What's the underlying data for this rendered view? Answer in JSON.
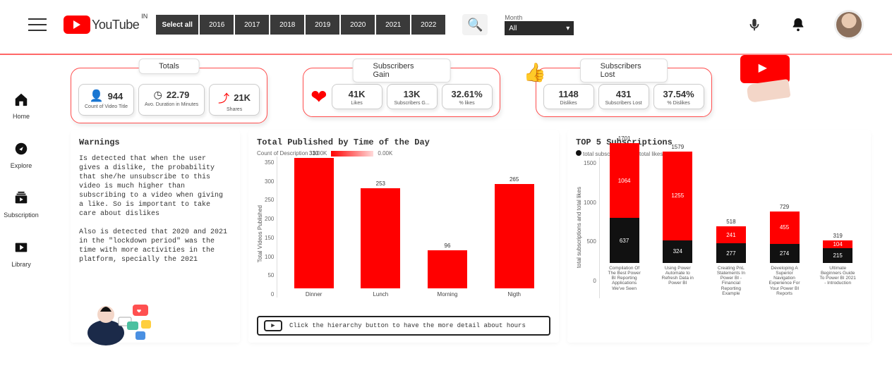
{
  "header": {
    "logo_text": "YouTube",
    "logo_sup": "IN",
    "select_all": "Select all",
    "years": [
      "2016",
      "2017",
      "2018",
      "2019",
      "2020",
      "2021",
      "2022"
    ],
    "month_label": "Month",
    "month_value": "All"
  },
  "nav": {
    "home": "Home",
    "explore": "Explore",
    "subscription": "Subscription",
    "library": "Library"
  },
  "kpi": {
    "totals": {
      "title": "Totals",
      "count_val": "944",
      "count_sub": "Count of Video Title",
      "dur_val": "22.79",
      "dur_sub": "Avo. Duration in Minutes",
      "shares_val": "21K",
      "shares_sub": "Shares"
    },
    "gain": {
      "title": "Subscribers Gain",
      "likes_val": "41K",
      "likes_sub": "Likes",
      "subg_val": "13K",
      "subg_sub": "Subscribers G...",
      "pct_val": "32.61%",
      "pct_sub": "% likes"
    },
    "lost": {
      "title": "Subscribers Lost",
      "dis_val": "1148",
      "dis_sub": "Dislikes",
      "subl_val": "431",
      "subl_sub": "Subscribers Lost",
      "pct_val": "37.54%",
      "pct_sub": "% Dislikes"
    }
  },
  "warnings": {
    "title": "Warnings",
    "p1": "Is detected that when the user gives a dislike, the probability that she/he unsubscribe to this video is much higher than subscribing to a video when giving a like. So is important to take care about dislikes",
    "p2": "Also is detected that 2020 and 2021 in the \"lockdown period\" was the time with more activities in the platform, specially the 2021"
  },
  "barchart": {
    "title": "Total Published by Time of the Day",
    "legend_label": "Count of Description",
    "legend_hi": "1.00K",
    "legend_lo": "0.00K",
    "ylab": "Total Vídeos Published",
    "hint": "Click the hierarchy button to  have the more  detail about hours"
  },
  "top5": {
    "title": "TOP 5 Subscriptions",
    "legend_subs": "total subscriptions",
    "legend_likes": "total likes",
    "ylab": "total subscriptions and total likes"
  },
  "chart_data": [
    {
      "type": "bar",
      "title": "Total Published by Time of the Day",
      "xlabel": "",
      "ylabel": "Total Vídeos Published",
      "ylim": [
        0,
        350
      ],
      "y_ticks": [
        0,
        50,
        100,
        150,
        200,
        250,
        300,
        350
      ],
      "categories": [
        "Dinner",
        "Lunch",
        "Morning",
        "Nigth"
      ],
      "values": [
        330,
        253,
        96,
        265
      ]
    },
    {
      "type": "bar",
      "title": "TOP 5 Subscriptions",
      "xlabel": "",
      "ylabel": "total subscriptions and total likes",
      "ylim": [
        0,
        1701
      ],
      "y_ticks": [
        0,
        500,
        1000,
        1500
      ],
      "categories": [
        "Compilation Of The Best Power BI Reporting Applications We've Seen",
        "Using Power Automate to Refresh Data in Power BI",
        "Creating PnL Statements In Power BI - Financial Reporting Example",
        "Developing A Superior Navigation Experience For Your Power BI Reports",
        "Ultimate Beginners Guide To Power BI 2021 - Introduction"
      ],
      "series": [
        {
          "name": "total subscriptions",
          "color": "#111111",
          "values": [
            637,
            324,
            277,
            274,
            215
          ]
        },
        {
          "name": "total likes",
          "color": "#ff0000",
          "values": [
            1064,
            1255,
            241,
            455,
            104
          ]
        }
      ],
      "totals": [
        1701,
        1579,
        518,
        729,
        319
      ],
      "stacked": true
    }
  ]
}
